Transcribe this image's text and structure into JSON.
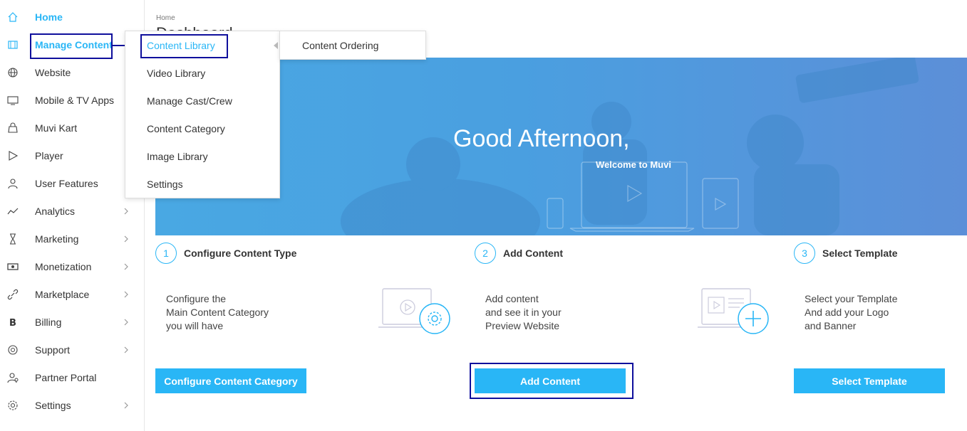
{
  "sidebar": {
    "items": [
      {
        "label": "Home",
        "icon": "home-icon",
        "chevron": false
      },
      {
        "label": "Manage Content",
        "icon": "film-icon",
        "chevron": false
      },
      {
        "label": "Website",
        "icon": "globe-icon",
        "chevron": false
      },
      {
        "label": "Mobile & TV Apps",
        "icon": "monitor-icon",
        "chevron": false
      },
      {
        "label": "Muvi Kart",
        "icon": "shopping-bag-icon",
        "chevron": false
      },
      {
        "label": "Player",
        "icon": "play-icon",
        "chevron": false
      },
      {
        "label": "User Features",
        "icon": "user-icon",
        "chevron": false
      },
      {
        "label": "Analytics",
        "icon": "trend-line-icon",
        "chevron": true
      },
      {
        "label": "Marketing",
        "icon": "hourglass-icon",
        "chevron": true
      },
      {
        "label": "Monetization",
        "icon": "money-icon",
        "chevron": true
      },
      {
        "label": "Marketplace",
        "icon": "link-icon",
        "chevron": true
      },
      {
        "label": "Billing",
        "icon": "bitcoin-icon",
        "chevron": true
      },
      {
        "label": "Support",
        "icon": "lifebuoy-icon",
        "chevron": true
      },
      {
        "label": "Partner Portal",
        "icon": "partner-icon",
        "chevron": false
      },
      {
        "label": "Settings",
        "icon": "gear-icon",
        "chevron": true
      }
    ]
  },
  "breadcrumb": "Home",
  "page_title": "Dashboard",
  "flyout": {
    "items": [
      "Content Library",
      "Video Library",
      "Manage Cast/Crew",
      "Content Category",
      "Image Library",
      "Settings"
    ],
    "submenu": [
      "Content Ordering"
    ]
  },
  "hero": {
    "title": "Good Afternoon,",
    "subtitle": "Welcome to Muvi"
  },
  "steps": [
    {
      "number": "1",
      "title": "Configure Content Type",
      "desc": [
        "Configure the",
        "Main Content Category",
        "you will have"
      ],
      "button": "Configure Content Category"
    },
    {
      "number": "2",
      "title": "Add Content",
      "desc": [
        "Add content",
        "and see it in your",
        "Preview Website"
      ],
      "button": "Add Content"
    },
    {
      "number": "3",
      "title": "Select Template",
      "desc": [
        "Select your Template",
        "And add your Logo",
        "and Banner"
      ],
      "button": "Select Template"
    }
  ],
  "colors": {
    "accent": "#29b6f6",
    "highlight": "#0f0f9c",
    "hero": "#4a9fe0"
  }
}
